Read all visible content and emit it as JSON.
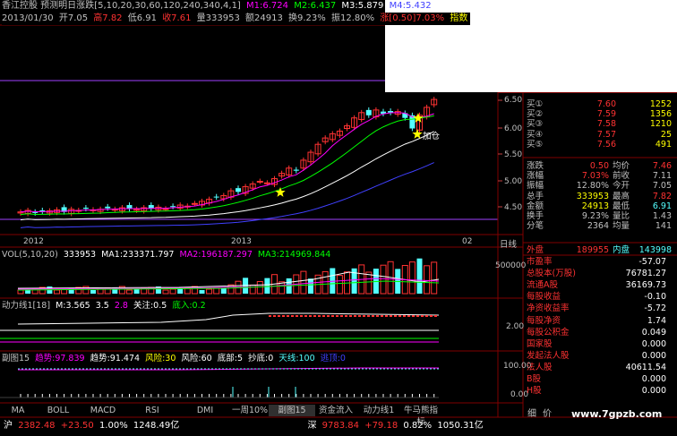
{
  "window": {
    "title": "香江控股 预测明日涨跌[5,10,20,30,60,120,240,340,4,1]"
  },
  "ma_header": {
    "m1": "M1:6.724",
    "m2": "M2:6.437",
    "m3": "M3:5.879",
    "m4": "M4:5.432"
  },
  "info_bar": {
    "date": "2013/01/30",
    "open": "开7.05",
    "high": "高7.82",
    "low": "低6.91",
    "close": "收7.61",
    "volume": "量333953",
    "amount": "额24913",
    "turnover": "换9.23%",
    "amplitude": "振12.80%",
    "change": "涨[0.50]7.03%",
    "indicator": "指数"
  },
  "price_axis": [
    "6.50",
    "6.00",
    "5.50",
    "5.00",
    "4.50"
  ],
  "annotation": {
    "add_position": "加仓"
  },
  "date_axis": {
    "left": "2012",
    "mid": "2013",
    "right": "02",
    "period": "日线"
  },
  "vol_header": {
    "name": "VOL(5,10,20)",
    "value": "333953",
    "ma1": "MA1:233371.797",
    "ma2": "MA2:196187.297",
    "ma3": "MA3:214969.844"
  },
  "vol_axis": [
    "500000"
  ],
  "power_header": {
    "name": "动力线1[18]",
    "m": "M:3.565",
    "v": "3.5",
    "v2": "2.8",
    "focus": "关注:0.5",
    "bottom": "底入:0.2"
  },
  "power_axis": [
    "2.00"
  ],
  "sub_header": {
    "name": "副图15",
    "trend1": "趋势:97.839",
    "trend2": "趋势:91.474",
    "risk": "风险:30",
    "risk2": "风险:60",
    "base": "底部:5",
    "bottom": "抄底:0",
    "sky": "天线:100",
    "escape": "逃顶:0"
  },
  "sub_axis": [
    "100.00",
    "0.00"
  ],
  "quote": {
    "buy": [
      {
        "label": "买①",
        "price": "7.60",
        "vol": "1252"
      },
      {
        "label": "买②",
        "price": "7.59",
        "vol": "1356"
      },
      {
        "label": "买③",
        "price": "7.58",
        "vol": "1210"
      },
      {
        "label": "买④",
        "price": "7.57",
        "vol": "25"
      },
      {
        "label": "买⑤",
        "price": "7.56",
        "vol": "491"
      }
    ],
    "stats": [
      {
        "l1": "涨跌",
        "v1": "0.50",
        "l2": "均价",
        "v2": "7.46"
      },
      {
        "l1": "涨幅",
        "v1": "7.03%",
        "l2": "前收",
        "v2": "7.11"
      },
      {
        "l1": "振幅",
        "v1": "12.80%",
        "l2": "今开",
        "v2": "7.05"
      },
      {
        "l1": "总手",
        "v1": "333953",
        "l2": "最高",
        "v2": "7.82"
      },
      {
        "l1": "金额",
        "v1": "24913",
        "l2": "最低",
        "v2": "6.91"
      },
      {
        "l1": "换手",
        "v1": "9.23%",
        "l2": "量比",
        "v2": "1.43"
      },
      {
        "l1": "分笔",
        "v1": "2364",
        "l2": "均量",
        "v2": "141"
      }
    ],
    "outer_label": "外盘",
    "outer": "189955",
    "inner_label": "内盘",
    "inner": "143998",
    "fundamentals": [
      {
        "l": "市盈率",
        "v": "-57.07"
      },
      {
        "l": "总股本(万股)",
        "v": "76781.27"
      },
      {
        "l": "流通A股",
        "v": "36169.73"
      },
      {
        "l": "每股收益",
        "v": "-0.10"
      },
      {
        "l": "净资收益率",
        "v": "-5.72"
      },
      {
        "l": "每股净资",
        "v": "1.74"
      },
      {
        "l": "每股公积金",
        "v": "0.049"
      },
      {
        "l": "国家股",
        "v": "0.000"
      },
      {
        "l": "发起法人股",
        "v": "0.000"
      },
      {
        "l": "法人股",
        "v": "40611.54"
      },
      {
        "l": "B股",
        "v": "0.000"
      },
      {
        "l": "H股",
        "v": "0.000"
      }
    ],
    "detail_tab": "细",
    "price_tab": "价"
  },
  "tabs": [
    "MA",
    "BOLL",
    "MACD",
    "RSI",
    "DMI",
    "一周10%",
    "副图15",
    "资金流入",
    "动力线1",
    "牛马熊指标"
  ],
  "status_bar": {
    "sh_label": "沪",
    "sh_index": "2382.48",
    "sh_change": "+23.50",
    "sh_pct": "1.00%",
    "sh_amount": "1248.49亿",
    "sz_label": "深",
    "sz_index": "9783.84",
    "sz_change": "+79.18",
    "sz_pct": "0.82%",
    "sz_amount": "1050.31亿"
  },
  "watermark": "www.7gpzb.com",
  "colors": {
    "up": "#ff3232",
    "down": "#54ffff",
    "yellow": "#ffff00",
    "magenta": "#ff00ff",
    "purple": "#a040ff"
  }
}
